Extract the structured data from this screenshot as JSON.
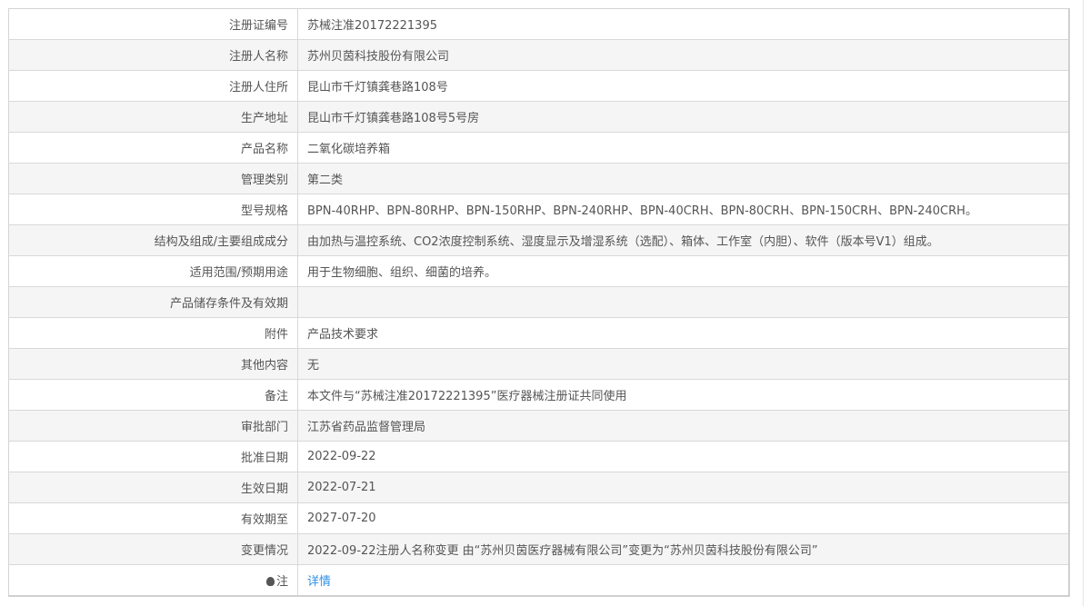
{
  "rows": [
    {
      "label": "注册证编号",
      "value": "苏械注准20172221395"
    },
    {
      "label": "注册人名称",
      "value": "苏州贝茵科技股份有限公司"
    },
    {
      "label": "注册人住所",
      "value": "昆山市千灯镇龚巷路108号"
    },
    {
      "label": "生产地址",
      "value": "昆山市千灯镇龚巷路108号5号房"
    },
    {
      "label": "产品名称",
      "value": "二氧化碳培养箱"
    },
    {
      "label": "管理类别",
      "value": "第二类"
    },
    {
      "label": "型号规格",
      "value": "BPN-40RHP、BPN-80RHP、BPN-150RHP、BPN-240RHP、BPN-40CRH、BPN-80CRH、BPN-150CRH、BPN-240CRH。"
    },
    {
      "label": "结构及组成/主要组成成分",
      "value": "由加热与温控系统、CO2浓度控制系统、湿度显示及增湿系统（选配）、箱体、工作室（内胆）、软件（版本号V1）组成。"
    },
    {
      "label": "适用范围/预期用途",
      "value": "用于生物细胞、组织、细菌的培养。"
    },
    {
      "label": "产品储存条件及有效期",
      "value": ""
    },
    {
      "label": "附件",
      "value": "产品技术要求"
    },
    {
      "label": "其他内容",
      "value": "无"
    },
    {
      "label": "备注",
      "value": "本文件与“苏械注准20172221395”医疗器械注册证共同使用"
    },
    {
      "label": "审批部门",
      "value": "江苏省药品监督管理局"
    },
    {
      "label": "批准日期",
      "value": "2022-09-22"
    },
    {
      "label": "生效日期",
      "value": "2022-07-21"
    },
    {
      "label": "有效期至",
      "value": "2027-07-20"
    },
    {
      "label": "变更情况",
      "value": "2022-09-22注册人名称变更 由“苏州贝茵医疗器械有限公司”变更为“苏州贝茵科技股份有限公司”"
    }
  ],
  "note": {
    "label": "注",
    "link": "详情",
    "icon": "bulb-icon"
  }
}
